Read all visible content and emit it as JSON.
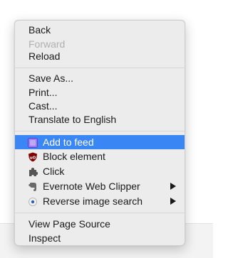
{
  "context_menu": {
    "groups": [
      [
        {
          "label": "Back",
          "disabled": false
        },
        {
          "label": "Forward",
          "disabled": true
        },
        {
          "label": "Reload",
          "disabled": false
        }
      ],
      [
        {
          "label": "Save As..."
        },
        {
          "label": "Print..."
        },
        {
          "label": "Cast..."
        },
        {
          "label": "Translate to English"
        }
      ],
      [
        {
          "label": "Add to feed",
          "icon": "add-to-feed-icon",
          "highlighted": true
        },
        {
          "label": "Block element",
          "icon": "ublock-shield-icon"
        },
        {
          "label": "Click",
          "icon": "puzzle-piece-icon"
        },
        {
          "label": "Evernote Web Clipper",
          "icon": "evernote-elephant-icon",
          "submenu": true
        },
        {
          "label": "Reverse image search",
          "icon": "reverse-image-search-icon",
          "submenu": true
        }
      ],
      [
        {
          "label": "View Page Source"
        },
        {
          "label": "Inspect"
        }
      ]
    ]
  },
  "colors": {
    "highlight": "#3a86f5",
    "menu_bg": "#ececec",
    "disabled_text": "#b0b0b0",
    "ublock_red": "#800000"
  }
}
